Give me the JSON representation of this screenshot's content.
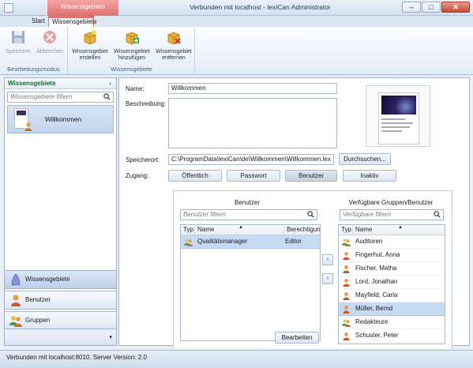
{
  "window": {
    "title": "Verbunden mit localhost - lexiCan Administrator",
    "context_tab_group": "Wissensgebiete",
    "buttons": {
      "minimize": "–",
      "maximize": "□",
      "close": "✕"
    }
  },
  "ribbon": {
    "tabs": [
      {
        "label": "Start"
      },
      {
        "label": "Wissensgebiete"
      }
    ],
    "groups": [
      {
        "label": "Bearbeitungsmodus",
        "buttons": [
          {
            "label": "Speichern",
            "icon": "floppy-disk-icon",
            "enabled": false
          },
          {
            "label": "Abbrechen",
            "icon": "cancel-icon",
            "enabled": false
          }
        ]
      },
      {
        "label": "Wissensgebiete",
        "buttons": [
          {
            "label": "Wissensgebiet erstellen",
            "icon": "box-new-icon",
            "enabled": true
          },
          {
            "label": "Wissensgebiet hinzufügen",
            "icon": "box-add-icon",
            "enabled": true
          },
          {
            "label": "Wissensgebiet entfernen",
            "icon": "box-remove-icon",
            "enabled": true
          }
        ]
      }
    ]
  },
  "sidebar": {
    "header": "Wissensgebiete",
    "collapse": "‹",
    "filter_placeholder": "Wissensgebiete filtern",
    "items": [
      {
        "label": "Willkommen"
      }
    ],
    "nav": [
      {
        "label": "Wissensgebiete",
        "icon": "knowledge-area-icon",
        "active": true
      },
      {
        "label": "Benutzer",
        "icon": "user-icon",
        "active": false
      },
      {
        "label": "Gruppen",
        "icon": "group-icon",
        "active": false
      }
    ],
    "footer_glyph": "▾"
  },
  "details": {
    "name_label": "Name:",
    "name_value": "Willkommen",
    "description_label": "Beschreibung:",
    "description_value": "",
    "location_label": "Speicherort:",
    "location_value": "C:\\ProgramData\\lexiCan\\de\\Willkommen\\Willkommen.lex",
    "browse_button": "Durchsuchen...",
    "access_label": "Zugang:",
    "access_options": [
      {
        "label": "Öffentlich",
        "selected": false
      },
      {
        "label": "Passwort",
        "selected": false
      },
      {
        "label": "Benutzer",
        "selected": true
      },
      {
        "label": "Inaktiv",
        "selected": false
      }
    ]
  },
  "users_panel": {
    "title": "Benutzer",
    "filter_placeholder": "Benutzer filtern",
    "columns": [
      "Typ",
      "Name",
      "Berechtigun"
    ],
    "rows": [
      {
        "icon": "group-icon",
        "name": "Qualitätsmanager",
        "role": "Editor",
        "selected": true
      }
    ],
    "edit_button": "Bearbeiten"
  },
  "transfer": {
    "add": "‹",
    "remove": "›"
  },
  "available_panel": {
    "title": "Verfügbare Gruppen/Benutzer",
    "filter_placeholder": "Verfügbare filtern",
    "columns": [
      "Typ",
      "Name"
    ],
    "rows": [
      {
        "icon": "group-icon",
        "name": "Auditoren",
        "selected": false
      },
      {
        "icon": "user-icon",
        "name": "Fingerhut, Anna",
        "selected": false
      },
      {
        "icon": "user-icon",
        "name": "Fischer, Matha",
        "selected": false
      },
      {
        "icon": "user-icon",
        "name": "Lord, Jonathan",
        "selected": false
      },
      {
        "icon": "user-icon",
        "name": "Mayfield, Carla",
        "selected": false
      },
      {
        "icon": "user-icon",
        "name": "Müller, Bernd",
        "selected": true
      },
      {
        "icon": "group-icon",
        "name": "Redakteure",
        "selected": false
      },
      {
        "icon": "user-icon",
        "name": "Schuster, Peter",
        "selected": false
      }
    ]
  },
  "statusbar": {
    "text": "Verbunden mit localhost:8010. Server Version: 2.0"
  },
  "colors": {
    "accent": "#e07070",
    "selection": "#c6daf3",
    "header_green": "#0d6b2e"
  }
}
